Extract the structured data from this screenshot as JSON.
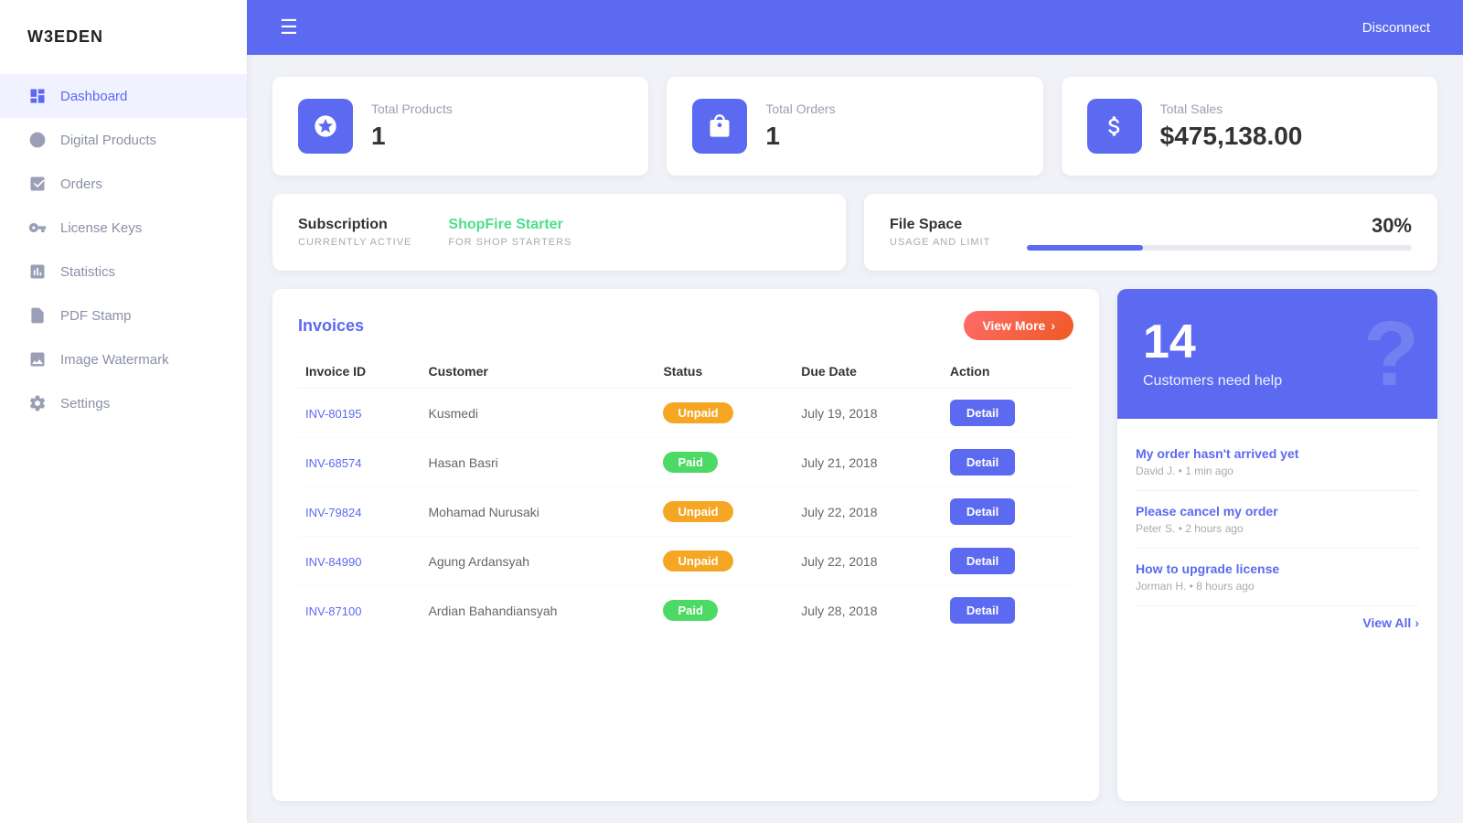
{
  "app": {
    "logo": "W3EDEN",
    "header": {
      "disconnect_label": "Disconnect"
    }
  },
  "sidebar": {
    "items": [
      {
        "id": "dashboard",
        "label": "Dashboard",
        "icon": "dashboard",
        "active": true
      },
      {
        "id": "digital-products",
        "label": "Digital Products",
        "icon": "digital-products",
        "active": false
      },
      {
        "id": "orders",
        "label": "Orders",
        "icon": "orders",
        "active": false
      },
      {
        "id": "license-keys",
        "label": "License Keys",
        "icon": "license-keys",
        "active": false
      },
      {
        "id": "statistics",
        "label": "Statistics",
        "icon": "statistics",
        "active": false
      },
      {
        "id": "pdf-stamp",
        "label": "PDF Stamp",
        "icon": "pdf-stamp",
        "active": false
      },
      {
        "id": "image-watermark",
        "label": "Image Watermark",
        "icon": "image-watermark",
        "active": false
      },
      {
        "id": "settings",
        "label": "Settings",
        "icon": "settings",
        "active": false
      }
    ]
  },
  "stats": {
    "total_products": {
      "label": "Total Products",
      "value": "1"
    },
    "total_orders": {
      "label": "Total Orders",
      "value": "1"
    },
    "total_sales": {
      "label": "Total Sales",
      "value": "$475,138.00"
    }
  },
  "subscription": {
    "title": "Subscription",
    "subtitle": "CURRENTLY ACTIVE",
    "plan": "ShopFire Starter",
    "plan_subtitle": "FOR SHOP STARTERS"
  },
  "filespace": {
    "title": "File Space",
    "subtitle": "USAGE AND LIMIT",
    "percent": "30%",
    "percent_value": 30
  },
  "invoices": {
    "title": "Invoices",
    "view_more": "View More",
    "columns": [
      "Invoice ID",
      "Customer",
      "Status",
      "Due Date",
      "Action"
    ],
    "rows": [
      {
        "id": "INV-80195",
        "customer": "Kusmedi",
        "status": "Unpaid",
        "due_date": "July 19, 2018"
      },
      {
        "id": "INV-68574",
        "customer": "Hasan Basri",
        "status": "Paid",
        "due_date": "July 21, 2018"
      },
      {
        "id": "INV-79824",
        "customer": "Mohamad Nurusaki",
        "status": "Unpaid",
        "due_date": "July 22, 2018"
      },
      {
        "id": "INV-84990",
        "customer": "Agung Ardansyah",
        "status": "Unpaid",
        "due_date": "July 22, 2018"
      },
      {
        "id": "INV-87100",
        "customer": "Ardian Bahandiansyah",
        "status": "Paid",
        "due_date": "July 28, 2018"
      }
    ],
    "detail_label": "Detail"
  },
  "customers_help": {
    "count": "14",
    "label": "Customers need help"
  },
  "tickets": [
    {
      "subject": "My order hasn't arrived yet",
      "meta": "David J.  •  1 min ago"
    },
    {
      "subject": "Please cancel my order",
      "meta": "Peter S.  •  2 hours ago"
    },
    {
      "subject": "How to upgrade license",
      "meta": "Jorman H.  •  8 hours ago"
    }
  ],
  "view_all_label": "View All"
}
